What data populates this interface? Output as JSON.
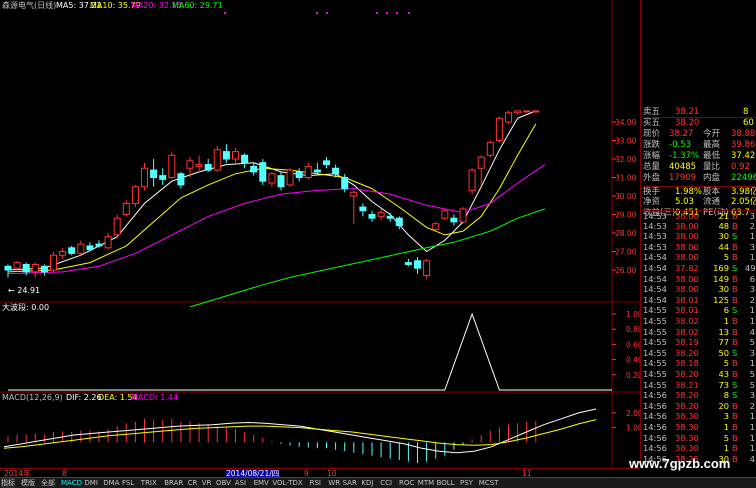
{
  "colors": {
    "up": "#ff3232",
    "down": "#54ffff",
    "ma5": "#ffffff",
    "ma10": "#ffff00",
    "ma20": "#ff00ff",
    "ma60": "#00ff00",
    "grid": "#800000",
    "axis": "#ff3232",
    "buy": "#ff3232",
    "sell": "#00ff00"
  },
  "header": {
    "title": "森源电气(日线)",
    "ma5": "MA5: 37.22",
    "ma10": "MA10: 35.79",
    "ma20": "MA20: 32.13",
    "ma60": "MA60: 29.71"
  },
  "chart_data": [
    {
      "type": "candlestick",
      "title": "森源电气(日线)",
      "ylim": [
        19.2,
        34.6
      ],
      "y_ticks": [
        34.0,
        33.0,
        32.0,
        31.0,
        30.0,
        29.0,
        28.0,
        27.0,
        26.0
      ],
      "min_label": "← 24.91",
      "candles": [
        {
          "o": 26.2,
          "h": 26.3,
          "c": 26.0,
          "l": 25.6
        },
        {
          "o": 26.1,
          "h": 26.5,
          "c": 26.4,
          "l": 25.9
        },
        {
          "o": 26.3,
          "h": 26.4,
          "c": 25.9,
          "l": 25.7
        },
        {
          "o": 25.9,
          "h": 26.4,
          "c": 26.3,
          "l": 25.6
        },
        {
          "o": 26.2,
          "h": 26.3,
          "c": 25.9,
          "l": 25.7
        },
        {
          "o": 26.0,
          "h": 27.0,
          "c": 26.8,
          "l": 25.9
        },
        {
          "o": 26.8,
          "h": 27.2,
          "c": 27.0,
          "l": 26.6
        },
        {
          "o": 27.2,
          "h": 27.3,
          "c": 26.9,
          "l": 26.8
        },
        {
          "o": 26.9,
          "h": 27.6,
          "c": 27.4,
          "l": 26.8
        },
        {
          "o": 27.3,
          "h": 27.5,
          "c": 27.1,
          "l": 27.0
        },
        {
          "o": 27.4,
          "h": 27.6,
          "c": 27.3,
          "l": 27.2
        },
        {
          "o": 27.2,
          "h": 28.0,
          "c": 27.8,
          "l": 27.1
        },
        {
          "o": 27.9,
          "h": 29.0,
          "c": 28.8,
          "l": 27.8
        },
        {
          "o": 29.0,
          "h": 29.8,
          "c": 29.6,
          "l": 28.9
        },
        {
          "o": 29.6,
          "h": 30.6,
          "c": 30.5,
          "l": 29.4
        },
        {
          "o": 30.5,
          "h": 31.8,
          "c": 31.5,
          "l": 30.3
        },
        {
          "o": 31.4,
          "h": 32.0,
          "c": 31.0,
          "l": 30.5
        },
        {
          "o": 31.1,
          "h": 31.5,
          "c": 30.9,
          "l": 30.6
        },
        {
          "o": 31.0,
          "h": 32.4,
          "c": 32.2,
          "l": 30.9
        },
        {
          "o": 31.2,
          "h": 31.3,
          "c": 30.6,
          "l": 30.4
        },
        {
          "o": 31.5,
          "h": 32.1,
          "c": 31.9,
          "l": 31.0
        },
        {
          "o": 31.6,
          "h": 32.2,
          "c": 31.7,
          "l": 31.3
        },
        {
          "o": 31.7,
          "h": 32.0,
          "c": 31.4,
          "l": 31.3
        },
        {
          "o": 31.4,
          "h": 32.7,
          "c": 32.5,
          "l": 31.3
        },
        {
          "o": 32.4,
          "h": 32.8,
          "c": 32.0,
          "l": 31.8
        },
        {
          "o": 32.0,
          "h": 32.6,
          "c": 32.4,
          "l": 31.8
        },
        {
          "o": 32.2,
          "h": 32.3,
          "c": 31.8,
          "l": 31.5
        },
        {
          "o": 31.6,
          "h": 31.8,
          "c": 31.3,
          "l": 31.1
        },
        {
          "o": 31.8,
          "h": 32.0,
          "c": 30.8,
          "l": 30.6
        },
        {
          "o": 30.7,
          "h": 31.3,
          "c": 31.2,
          "l": 30.5
        },
        {
          "o": 31.1,
          "h": 31.3,
          "c": 30.5,
          "l": 30.3
        },
        {
          "o": 30.6,
          "h": 31.5,
          "c": 31.4,
          "l": 30.5
        },
        {
          "o": 31.3,
          "h": 31.5,
          "c": 31.0,
          "l": 30.8
        },
        {
          "o": 31.0,
          "h": 31.8,
          "c": 31.6,
          "l": 30.9
        },
        {
          "o": 31.4,
          "h": 31.8,
          "c": 31.3,
          "l": 31.2
        },
        {
          "o": 31.9,
          "h": 32.1,
          "c": 31.7,
          "l": 31.5
        },
        {
          "o": 31.5,
          "h": 31.7,
          "c": 31.2,
          "l": 31.0
        },
        {
          "o": 31.0,
          "h": 31.2,
          "c": 30.4,
          "l": 30.2
        },
        {
          "o": 30.0,
          "h": 30.3,
          "c": 30.2,
          "l": 28.5
        },
        {
          "o": 29.4,
          "h": 29.6,
          "c": 29.2,
          "l": 28.9
        },
        {
          "o": 29.0,
          "h": 29.2,
          "c": 28.8,
          "l": 28.6
        },
        {
          "o": 28.9,
          "h": 29.3,
          "c": 29.1,
          "l": 28.7
        },
        {
          "o": 28.9,
          "h": 29.1,
          "c": 28.8,
          "l": 28.6
        },
        {
          "o": 28.8,
          "h": 28.9,
          "c": 28.4,
          "l": 28.2
        },
        {
          "o": 26.4,
          "h": 26.6,
          "c": 26.3,
          "l": 26.2
        },
        {
          "o": 26.5,
          "h": 26.7,
          "c": 26.1,
          "l": 25.8
        },
        {
          "o": 25.7,
          "h": 26.6,
          "c": 26.5,
          "l": 25.5
        },
        {
          "o": 28.2,
          "h": 28.6,
          "c": 28.5,
          "l": 28.1
        },
        {
          "o": 28.8,
          "h": 29.3,
          "c": 29.2,
          "l": 28.7
        },
        {
          "o": 28.8,
          "h": 29.0,
          "c": 28.6,
          "l": 28.4
        },
        {
          "o": 28.6,
          "h": 29.4,
          "c": 29.3,
          "l": 28.5
        },
        {
          "o": 30.3,
          "h": 31.5,
          "c": 31.4,
          "l": 30.1
        },
        {
          "o": 31.5,
          "h": 32.2,
          "c": 32.1,
          "l": 30.6
        },
        {
          "o": 32.2,
          "h": 33.0,
          "c": 32.9,
          "l": 32.1
        },
        {
          "o": 33.0,
          "h": 34.3,
          "c": 34.2,
          "l": 32.9
        },
        {
          "o": 34.0,
          "h": 34.6,
          "c": 34.5,
          "l": 33.9
        },
        {
          "o": 34.5,
          "h": 34.6,
          "c": 34.6,
          "l": 34.4
        },
        {
          "o": 34.6,
          "h": 34.6,
          "c": 34.6,
          "l": 34.5
        },
        {
          "o": 34.6,
          "h": 34.6,
          "c": 34.6,
          "l": 34.5
        }
      ],
      "series": [
        {
          "name": "MA5",
          "color": "#ffffff",
          "points": [
            [
              0,
              26.0
            ],
            [
              4,
              26.1
            ],
            [
              8,
              26.8
            ],
            [
              12,
              27.8
            ],
            [
              15,
              29.6
            ],
            [
              18,
              30.8
            ],
            [
              21,
              31.3
            ],
            [
              24,
              31.7
            ],
            [
              27,
              31.8
            ],
            [
              30,
              31.3
            ],
            [
              33,
              31.1
            ],
            [
              36,
              31.2
            ],
            [
              38,
              30.6
            ],
            [
              40,
              29.7
            ],
            [
              42,
              29.0
            ],
            [
              44,
              27.9
            ],
            [
              46,
              27.0
            ],
            [
              48,
              27.6
            ],
            [
              50,
              28.6
            ],
            [
              52,
              30.5
            ],
            [
              54,
              32.5
            ],
            [
              56,
              34.2
            ],
            [
              58,
              34.6
            ]
          ]
        },
        {
          "name": "MA10",
          "color": "#ffff00",
          "points": [
            [
              0,
              25.9
            ],
            [
              5,
              26.0
            ],
            [
              9,
              26.4
            ],
            [
              13,
              27.3
            ],
            [
              16,
              28.6
            ],
            [
              19,
              29.9
            ],
            [
              22,
              30.6
            ],
            [
              25,
              31.2
            ],
            [
              28,
              31.5
            ],
            [
              31,
              31.4
            ],
            [
              34,
              31.2
            ],
            [
              37,
              31.0
            ],
            [
              40,
              30.4
            ],
            [
              43,
              29.4
            ],
            [
              46,
              28.3
            ],
            [
              48,
              27.9
            ],
            [
              50,
              28.1
            ],
            [
              52,
              28.9
            ],
            [
              54,
              30.4
            ],
            [
              56,
              32.2
            ],
            [
              58,
              33.9
            ]
          ]
        },
        {
          "name": "MA20",
          "color": "#ff00ff",
          "points": [
            [
              0,
              25.8
            ],
            [
              6,
              25.9
            ],
            [
              10,
              26.2
            ],
            [
              14,
              26.9
            ],
            [
              18,
              27.9
            ],
            [
              22,
              28.9
            ],
            [
              26,
              29.6
            ],
            [
              30,
              30.1
            ],
            [
              34,
              30.3
            ],
            [
              38,
              30.4
            ],
            [
              42,
              30.1
            ],
            [
              46,
              29.5
            ],
            [
              50,
              29.1
            ],
            [
              53,
              29.6
            ],
            [
              56,
              30.7
            ],
            [
              59,
              31.7
            ]
          ]
        },
        {
          "name": "MA60",
          "color": "#00ff00",
          "points": [
            [
              20,
              24.0
            ],
            [
              24,
              24.6
            ],
            [
              28,
              25.2
            ],
            [
              31,
              25.6
            ],
            [
              46,
              27.2
            ],
            [
              49,
              27.5
            ],
            [
              53,
              28.1
            ],
            [
              56,
              28.8
            ],
            [
              59,
              29.3
            ]
          ]
        }
      ]
    },
    {
      "type": "line",
      "title": "大波段",
      "series_label": "大波段: 0.00",
      "ylim": [
        0,
        1.0
      ],
      "y_ticks": [
        "1.00",
        "0.80",
        "0.60",
        "0.40",
        "0.20"
      ],
      "points": [
        [
          0,
          0
        ],
        [
          48,
          0
        ],
        [
          51,
          1.0
        ],
        [
          54,
          0
        ],
        [
          80,
          0
        ]
      ]
    },
    {
      "type": "bar+line",
      "title": "MACD(12,26,9)",
      "dif_label": "DIF: 2.26",
      "dea_label": "DEA: 1.54",
      "macd_label": "MACD: 1.44",
      "ylim": [
        -1.6,
        2.6
      ],
      "y_ticks": [
        "2.00",
        "1.00"
      ],
      "macd": [
        0.4,
        0.5,
        0.55,
        0.6,
        0.55,
        0.7,
        0.75,
        0.7,
        0.8,
        0.8,
        0.75,
        0.9,
        1.1,
        1.3,
        1.4,
        1.6,
        1.55,
        1.5,
        1.6,
        1.4,
        1.4,
        1.3,
        1.2,
        1.1,
        1.0,
        0.9,
        0.7,
        0.5,
        0.3,
        0.1,
        -0.1,
        -0.2,
        -0.3,
        -0.35,
        -0.4,
        -0.4,
        -0.5,
        -0.6,
        -0.7,
        -0.8,
        -0.9,
        -1.0,
        -1.1,
        -1.2,
        -1.3,
        -1.4,
        -1.3,
        -1.1,
        -0.9,
        -0.5,
        -0.2,
        0.2,
        0.5,
        0.8,
        1.0,
        1.2,
        1.3,
        1.4,
        1.44
      ],
      "dif": [
        -0.3,
        -0.1,
        0.1,
        0.3,
        0.5,
        0.6,
        0.7,
        0.8,
        0.9,
        1.0,
        1.1,
        1.15,
        1.2,
        1.3,
        1.35,
        1.3,
        1.2,
        1.1,
        0.9,
        0.7,
        0.5,
        0.3,
        0.1,
        -0.1,
        -0.4,
        -0.6,
        -0.7,
        -0.6,
        -0.3,
        0.2,
        0.7,
        1.2,
        1.6,
        2.0,
        2.26
      ],
      "dea": [
        -0.4,
        -0.3,
        -0.15,
        0.0,
        0.15,
        0.3,
        0.45,
        0.55,
        0.65,
        0.75,
        0.85,
        0.95,
        1.0,
        1.05,
        1.1,
        1.1,
        1.05,
        1.0,
        0.9,
        0.8,
        0.7,
        0.55,
        0.4,
        0.25,
        0.1,
        -0.05,
        -0.15,
        -0.2,
        -0.15,
        0.05,
        0.3,
        0.6,
        0.9,
        1.25,
        1.54
      ]
    }
  ],
  "dates": {
    "start": "2014年",
    "m1": "8",
    "mid": "2014/08/21/四",
    "m2": "9",
    "m3": "10",
    "m4": "11"
  },
  "quote": {
    "sell5": {
      "label": "卖五",
      "price": "38.21",
      "vol": "8"
    },
    "buy5": {
      "label": "买五",
      "price": "38.20",
      "vol": "60"
    },
    "rows": [
      {
        "l1": "现价",
        "v1": "38.27",
        "l2": "今开",
        "v2": "38.88",
        "c1": "#ff3232",
        "c2": "#ff3232"
      },
      {
        "l1": "涨跌",
        "v1": "-0.53",
        "l2": "最高",
        "v2": "39.86",
        "c1": "#00ff00",
        "c2": "#ff3232"
      },
      {
        "l1": "涨幅",
        "v1": "-1.37%",
        "l2": "最低",
        "v2": "37.42",
        "c1": "#00ff00",
        "c2": "#ffff00"
      },
      {
        "l1": "总量",
        "v1": "40485",
        "l2": "量比",
        "v2": "0.92",
        "c1": "#ffff00",
        "c2": "#ff3232"
      },
      {
        "l1": "外盘",
        "v1": "17909",
        "l2": "内盘",
        "v2": "22496",
        "c1": "#ff3232",
        "c2": "#00ff00"
      }
    ],
    "rows2": [
      {
        "l1": "换手",
        "v1": "1.98%",
        "l2": "股本",
        "v2": "3.98亿"
      },
      {
        "l1": "净资",
        "v1": "5.03",
        "l2": "流通",
        "v2": "2.05亿"
      },
      {
        "l1": "收益(三)",
        "v1": "0.451",
        "l2": "PE(动)",
        "v2": "63.7"
      }
    ]
  },
  "ticks": [
    {
      "t": "14:53",
      "p": "38.00",
      "v": "21",
      "d": "B",
      "n": "3"
    },
    {
      "t": "14:53",
      "p": "38.00",
      "v": "48",
      "d": "B",
      "n": "2"
    },
    {
      "t": "14:53",
      "p": "38.00",
      "v": "30",
      "d": "S",
      "n": "1"
    },
    {
      "t": "14:53",
      "p": "38.00",
      "v": "44",
      "d": "B",
      "n": "3"
    },
    {
      "t": "14:54",
      "p": "38.00",
      "v": "5",
      "d": "B",
      "n": "1"
    },
    {
      "t": "14:54",
      "p": "37.82",
      "v": "169",
      "d": "S",
      "n": "49"
    },
    {
      "t": "14:54",
      "p": "38.00",
      "v": "149",
      "d": "B",
      "n": "6"
    },
    {
      "t": "14:54",
      "p": "38.00",
      "v": "30",
      "d": "B",
      "n": "3"
    },
    {
      "t": "14:54",
      "p": "38.01",
      "v": "125",
      "d": "B",
      "n": "2"
    },
    {
      "t": "14:55",
      "p": "38.01",
      "v": "6",
      "d": "S",
      "n": "1"
    },
    {
      "t": "14:55",
      "p": "38.02",
      "v": "1",
      "d": "B",
      "n": "1"
    },
    {
      "t": "14:55",
      "p": "38.02",
      "v": "13",
      "d": "B",
      "n": "4"
    },
    {
      "t": "14:55",
      "p": "38.19",
      "v": "77",
      "d": "B",
      "n": "5"
    },
    {
      "t": "14:55",
      "p": "38.20",
      "v": "50",
      "d": "S",
      "n": "3"
    },
    {
      "t": "14:55",
      "p": "38.18",
      "v": "5",
      "d": "B",
      "n": "1"
    },
    {
      "t": "14:55",
      "p": "38.20",
      "v": "43",
      "d": "B",
      "n": "5"
    },
    {
      "t": "14:55",
      "p": "38.21",
      "v": "73",
      "d": "S",
      "n": "5"
    },
    {
      "t": "14:56",
      "p": "38.20",
      "v": "8",
      "d": "S",
      "n": "3"
    },
    {
      "t": "14:56",
      "p": "38.20",
      "v": "20",
      "d": "B",
      "n": "2"
    },
    {
      "t": "14:56",
      "p": "38.30",
      "v": "3",
      "d": "B",
      "n": "1"
    },
    {
      "t": "14:56",
      "p": "38.30",
      "v": "1",
      "d": "B",
      "n": "1"
    },
    {
      "t": "14:56",
      "p": "38.30",
      "v": "5",
      "d": "B",
      "n": "1"
    },
    {
      "t": "14:56",
      "p": "38.30",
      "v": "1",
      "d": "B",
      "n": "1"
    },
    {
      "t": "14:56",
      "p": "38.25",
      "v": "30",
      "d": "B",
      "n": "4"
    }
  ],
  "tabs": [
    "指标",
    "模版",
    "全部",
    "MACD",
    "DMI",
    "DMA",
    "FSL",
    "TRIX",
    "BRAR",
    "CR",
    "VR",
    "OBV",
    "ASI",
    "EMV",
    "VOL-TDX",
    "RSI",
    "WR",
    "SAR",
    "KDJ",
    "CCI",
    "ROC",
    "MTM",
    "BOLL",
    "PSY",
    "MCST"
  ],
  "watermark": "www.7gpzb.com"
}
